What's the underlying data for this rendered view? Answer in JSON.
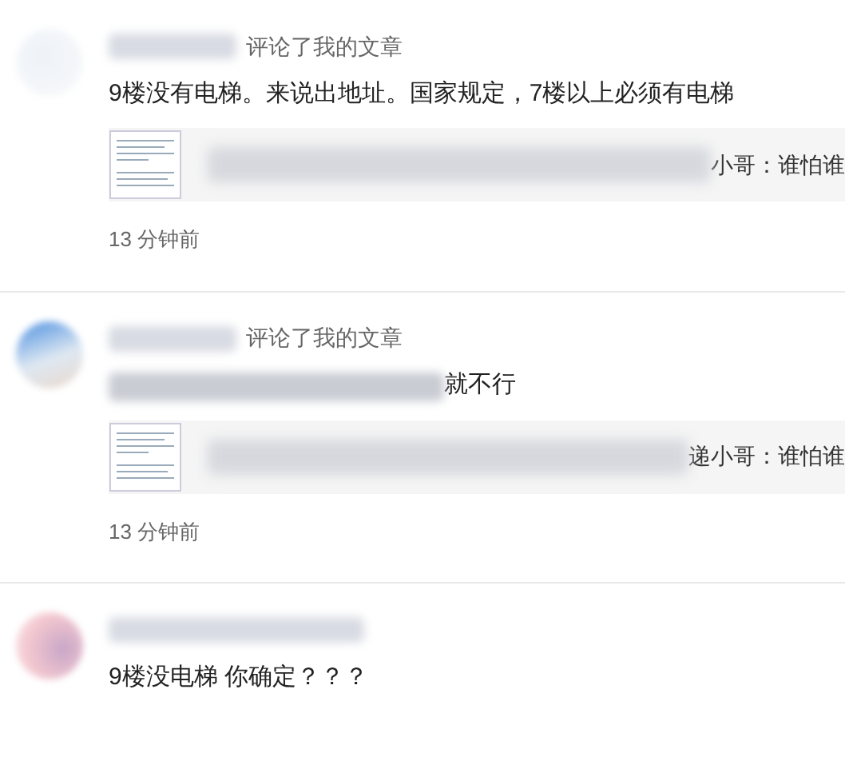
{
  "notifications": [
    {
      "action": "评论了我的文章",
      "comment": "9楼没有电梯。来说出地址。国家规定，7楼以上必须有电梯",
      "comment_redacted": false,
      "quote": "小哥：谁怕谁",
      "time": "13 分钟前"
    },
    {
      "action": "评论了我的文章",
      "comment": "就不行",
      "comment_redacted": true,
      "quote": "递小哥：谁怕谁",
      "time": "13 分钟前"
    },
    {
      "comment": "9楼没电梯 你确定？？？",
      "comment_redacted": false
    }
  ]
}
